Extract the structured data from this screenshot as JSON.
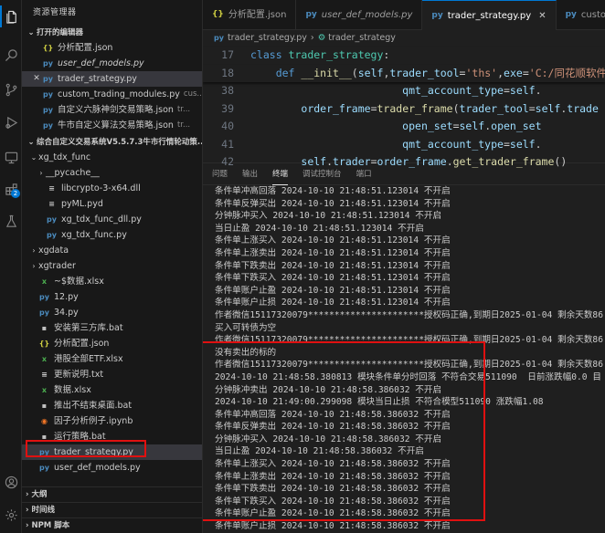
{
  "activity_bar": {
    "items": [
      {
        "icon": "files-icon"
      },
      {
        "icon": "search-icon"
      },
      {
        "icon": "source-control-icon"
      },
      {
        "icon": "run-debug-icon"
      },
      {
        "icon": "remote-explorer-icon"
      },
      {
        "icon": "extensions-icon",
        "badge": "2"
      },
      {
        "icon": "testing-icon"
      },
      {
        "icon": "account-icon"
      },
      {
        "icon": "settings-gear-icon"
      }
    ]
  },
  "sidebar": {
    "title": "资源管理器",
    "open_editors_label": "打开的编辑器",
    "open_editors": [
      {
        "icon": "{}",
        "kind": "json",
        "name": "分析配置.json",
        "path": "",
        "italic": false
      },
      {
        "icon": "py",
        "kind": "py",
        "name": "user_def_models.py",
        "path": "",
        "italic": true
      },
      {
        "icon": "py",
        "kind": "py",
        "name": "trader_strategy.py",
        "path": "",
        "italic": false,
        "close": "✕",
        "selected": true
      },
      {
        "icon": "py",
        "kind": "py",
        "name": "custom_trading_modules.py",
        "path": "cus...",
        "italic": false
      },
      {
        "icon": "py",
        "kind": "py",
        "name": "自定义六脉神剑交易策略.json",
        "path": "tr...",
        "italic": false
      },
      {
        "icon": "py",
        "kind": "py",
        "name": "牛市自定义算法交易策略.json",
        "path": "tr...",
        "italic": false
      }
    ],
    "workspace_label": "综合自定义交易系统V5.5.7.3牛市行情轮动策...",
    "tree": [
      {
        "indent": 1,
        "arrow": "⌄",
        "icon": "",
        "kind": "",
        "name": "xg_tdx_func"
      },
      {
        "indent": 2,
        "arrow": "›",
        "icon": "",
        "kind": "",
        "name": "__pycache__"
      },
      {
        "indent": 2,
        "arrow": "",
        "icon": "≡",
        "kind": "dll",
        "name": "libcrypto-3-x64.dll"
      },
      {
        "indent": 2,
        "arrow": "",
        "icon": "≡",
        "kind": "pyd",
        "name": "pyML.pyd"
      },
      {
        "indent": 2,
        "arrow": "",
        "icon": "py",
        "kind": "py",
        "name": "xg_tdx_func_dll.py"
      },
      {
        "indent": 2,
        "arrow": "",
        "icon": "py",
        "kind": "py",
        "name": "xg_tdx_func.py"
      },
      {
        "indent": 1,
        "arrow": "›",
        "icon": "",
        "kind": "",
        "name": "xgdata"
      },
      {
        "indent": 1,
        "arrow": "›",
        "icon": "",
        "kind": "",
        "name": "xgtrader"
      },
      {
        "indent": 1,
        "arrow": "",
        "icon": "x",
        "kind": "xlsx",
        "name": "~$数据.xlsx"
      },
      {
        "indent": 1,
        "arrow": "",
        "icon": "py",
        "kind": "py",
        "name": "12.py"
      },
      {
        "indent": 1,
        "arrow": "",
        "icon": "py",
        "kind": "py",
        "name": "34.py"
      },
      {
        "indent": 1,
        "arrow": "",
        "icon": "▪",
        "kind": "bat",
        "name": "安装第三方库.bat"
      },
      {
        "indent": 1,
        "arrow": "",
        "icon": "{}",
        "kind": "json",
        "name": "分析配置.json"
      },
      {
        "indent": 1,
        "arrow": "",
        "icon": "x",
        "kind": "xlsx",
        "name": "港股全部ETF.xlsx"
      },
      {
        "indent": 1,
        "arrow": "",
        "icon": "≡",
        "kind": "txt",
        "name": "更新说明.txt"
      },
      {
        "indent": 1,
        "arrow": "",
        "icon": "x",
        "kind": "xlsx",
        "name": "数据.xlsx"
      },
      {
        "indent": 1,
        "arrow": "",
        "icon": "▪",
        "kind": "bat",
        "name": "推出不结束桌面.bat"
      },
      {
        "indent": 1,
        "arrow": "",
        "icon": "◉",
        "kind": "ipynb",
        "name": "因子分析例子.ipynb"
      },
      {
        "indent": 1,
        "arrow": "",
        "icon": "▪",
        "kind": "bat",
        "name": "运行策略.bat"
      },
      {
        "indent": 1,
        "arrow": "",
        "icon": "py",
        "kind": "py",
        "name": "trader_strategy.py",
        "selected": true
      },
      {
        "indent": 1,
        "arrow": "",
        "icon": "py",
        "kind": "py",
        "name": "user_def_models.py"
      }
    ],
    "bottom_sections": [
      "大纲",
      "时间线",
      "NPM 脚本"
    ]
  },
  "tabs": [
    {
      "icon": "{}",
      "kind": "json",
      "label": "分析配置.json",
      "italic": false,
      "active": false
    },
    {
      "icon": "py",
      "kind": "py",
      "label": "user_def_models.py",
      "italic": true,
      "active": false
    },
    {
      "icon": "py",
      "kind": "py",
      "label": "trader_strategy.py",
      "italic": false,
      "active": true,
      "close": "✕"
    },
    {
      "icon": "py",
      "kind": "py",
      "label": "custom_trading",
      "italic": false,
      "active": false
    }
  ],
  "breadcrumb": [
    "trader_strategy.py",
    "trader_strategy"
  ],
  "code": [
    {
      "line": "17",
      "sticky": true,
      "segments": [
        {
          "t": "kw",
          "v": "class "
        },
        {
          "t": "cls",
          "v": "trader_strategy"
        },
        {
          "t": "",
          "v": ":"
        }
      ]
    },
    {
      "line": "18",
      "sticky": true,
      "segments": [
        {
          "t": "",
          "v": "    "
        },
        {
          "t": "kw",
          "v": "def "
        },
        {
          "t": "fn",
          "v": "__init__"
        },
        {
          "t": "",
          "v": "("
        },
        {
          "t": "var",
          "v": "self"
        },
        {
          "t": "",
          "v": ","
        },
        {
          "t": "var",
          "v": "trader_tool"
        },
        {
          "t": "",
          "v": "="
        },
        {
          "t": "str",
          "v": "'ths'"
        },
        {
          "t": "",
          "v": ","
        },
        {
          "t": "var",
          "v": "exe"
        },
        {
          "t": "",
          "v": "="
        },
        {
          "t": "str",
          "v": "'C:/同花顺软件"
        }
      ]
    },
    {
      "line": "38",
      "sticky": false,
      "segments": [
        {
          "t": "",
          "v": "                        "
        },
        {
          "t": "var",
          "v": "qmt_account_type"
        },
        {
          "t": "",
          "v": "="
        },
        {
          "t": "var",
          "v": "self"
        },
        {
          "t": "",
          "v": "."
        }
      ]
    },
    {
      "line": "39",
      "sticky": false,
      "segments": [
        {
          "t": "",
          "v": "        "
        },
        {
          "t": "var",
          "v": "order_frame"
        },
        {
          "t": "",
          "v": "="
        },
        {
          "t": "fn",
          "v": "trader_frame"
        },
        {
          "t": "",
          "v": "("
        },
        {
          "t": "var",
          "v": "trader_tool"
        },
        {
          "t": "",
          "v": "="
        },
        {
          "t": "var",
          "v": "self"
        },
        {
          "t": "",
          "v": "."
        },
        {
          "t": "var",
          "v": "trade"
        }
      ]
    },
    {
      "line": "40",
      "sticky": false,
      "segments": [
        {
          "t": "",
          "v": "                        "
        },
        {
          "t": "var",
          "v": "open_set"
        },
        {
          "t": "",
          "v": "="
        },
        {
          "t": "var",
          "v": "self"
        },
        {
          "t": "",
          "v": "."
        },
        {
          "t": "var",
          "v": "open_set"
        }
      ]
    },
    {
      "line": "41",
      "sticky": false,
      "segments": [
        {
          "t": "",
          "v": "                        "
        },
        {
          "t": "var",
          "v": "qmt_account_type"
        },
        {
          "t": "",
          "v": "="
        },
        {
          "t": "var",
          "v": "self"
        },
        {
          "t": "",
          "v": "."
        }
      ]
    },
    {
      "line": "42",
      "sticky": false,
      "segments": [
        {
          "t": "",
          "v": "        "
        },
        {
          "t": "var",
          "v": "self"
        },
        {
          "t": "",
          "v": "."
        },
        {
          "t": "var",
          "v": "trader"
        },
        {
          "t": "",
          "v": "="
        },
        {
          "t": "var",
          "v": "order_frame"
        },
        {
          "t": "",
          "v": "."
        },
        {
          "t": "fn",
          "v": "get_trader_frame"
        },
        {
          "t": "",
          "v": "()"
        }
      ]
    }
  ],
  "panel": {
    "tabs": [
      "问题",
      "输出",
      "终端",
      "调试控制台",
      "端口"
    ],
    "active_tab": "终端",
    "lines": [
      "条件单冲高回落 2024-10-10 21:48:51.123014 不开启",
      "条件单反弹买出 2024-10-10 21:48:51.123014 不开启",
      "分钟脉冲买入 2024-10-10 21:48:51.123014 不开启",
      "当日止盈 2024-10-10 21:48:51.123014 不开启",
      "条件单上涨买入 2024-10-10 21:48:51.123014 不开启",
      "条件单上涨卖出 2024-10-10 21:48:51.123014 不开启",
      "条件单下跌卖出 2024-10-10 21:48:51.123014 不开启",
      "条件单下跌买入 2024-10-10 21:48:51.123014 不开启",
      "条件单账户止盈 2024-10-10 21:48:51.123014 不开启",
      "条件单账户止损 2024-10-10 21:48:51.123014 不开启",
      "作者微信15117320079**********************授权码正确,到期日2025-01-04 剩余天数86",
      "买入可转债为空",
      "作者微信15117320079**********************授权码正确,到期日2025-01-04 剩余天数86",
      "没有卖出的标的",
      "作者微信15117320079**********************授权码正确,到期日2025-01-04 剩余天数86",
      "2024-10-10 21:48:58.380813 模块条件单分时回落 不符合交易511090  日前涨跌幅0.0 目",
      "分钟脉冲卖出 2024-10-10 21:48:58.386032 不开启",
      "2024-10-10 21:49:00.299098 模块当日止损 不符合模型511090 涨跌幅1.08",
      "条件单冲高回落 2024-10-10 21:48:58.386032 不开启",
      "条件单反弹卖出 2024-10-10 21:48:58.386032 不开启",
      "分钟脉冲买入 2024-10-10 21:48:58.386032 不开启",
      "当日止盈 2024-10-10 21:48:58.386032 不开启",
      "条件单上涨买入 2024-10-10 21:48:58.386032 不开启",
      "条件单上涨卖出 2024-10-10 21:48:58.386032 不开启",
      "条件单下跌卖出 2024-10-10 21:48:58.386032 不开启",
      "条件单下跌买入 2024-10-10 21:48:58.386032 不开启",
      "条件单账户止盈 2024-10-10 21:48:58.386032 不开启",
      "条件单账户止损 2024-10-10 21:48:58.386032 不开启"
    ]
  },
  "colors": {
    "accent": "#0078d4",
    "highlight_box": "#e01010",
    "background": "#1e1e1e"
  }
}
